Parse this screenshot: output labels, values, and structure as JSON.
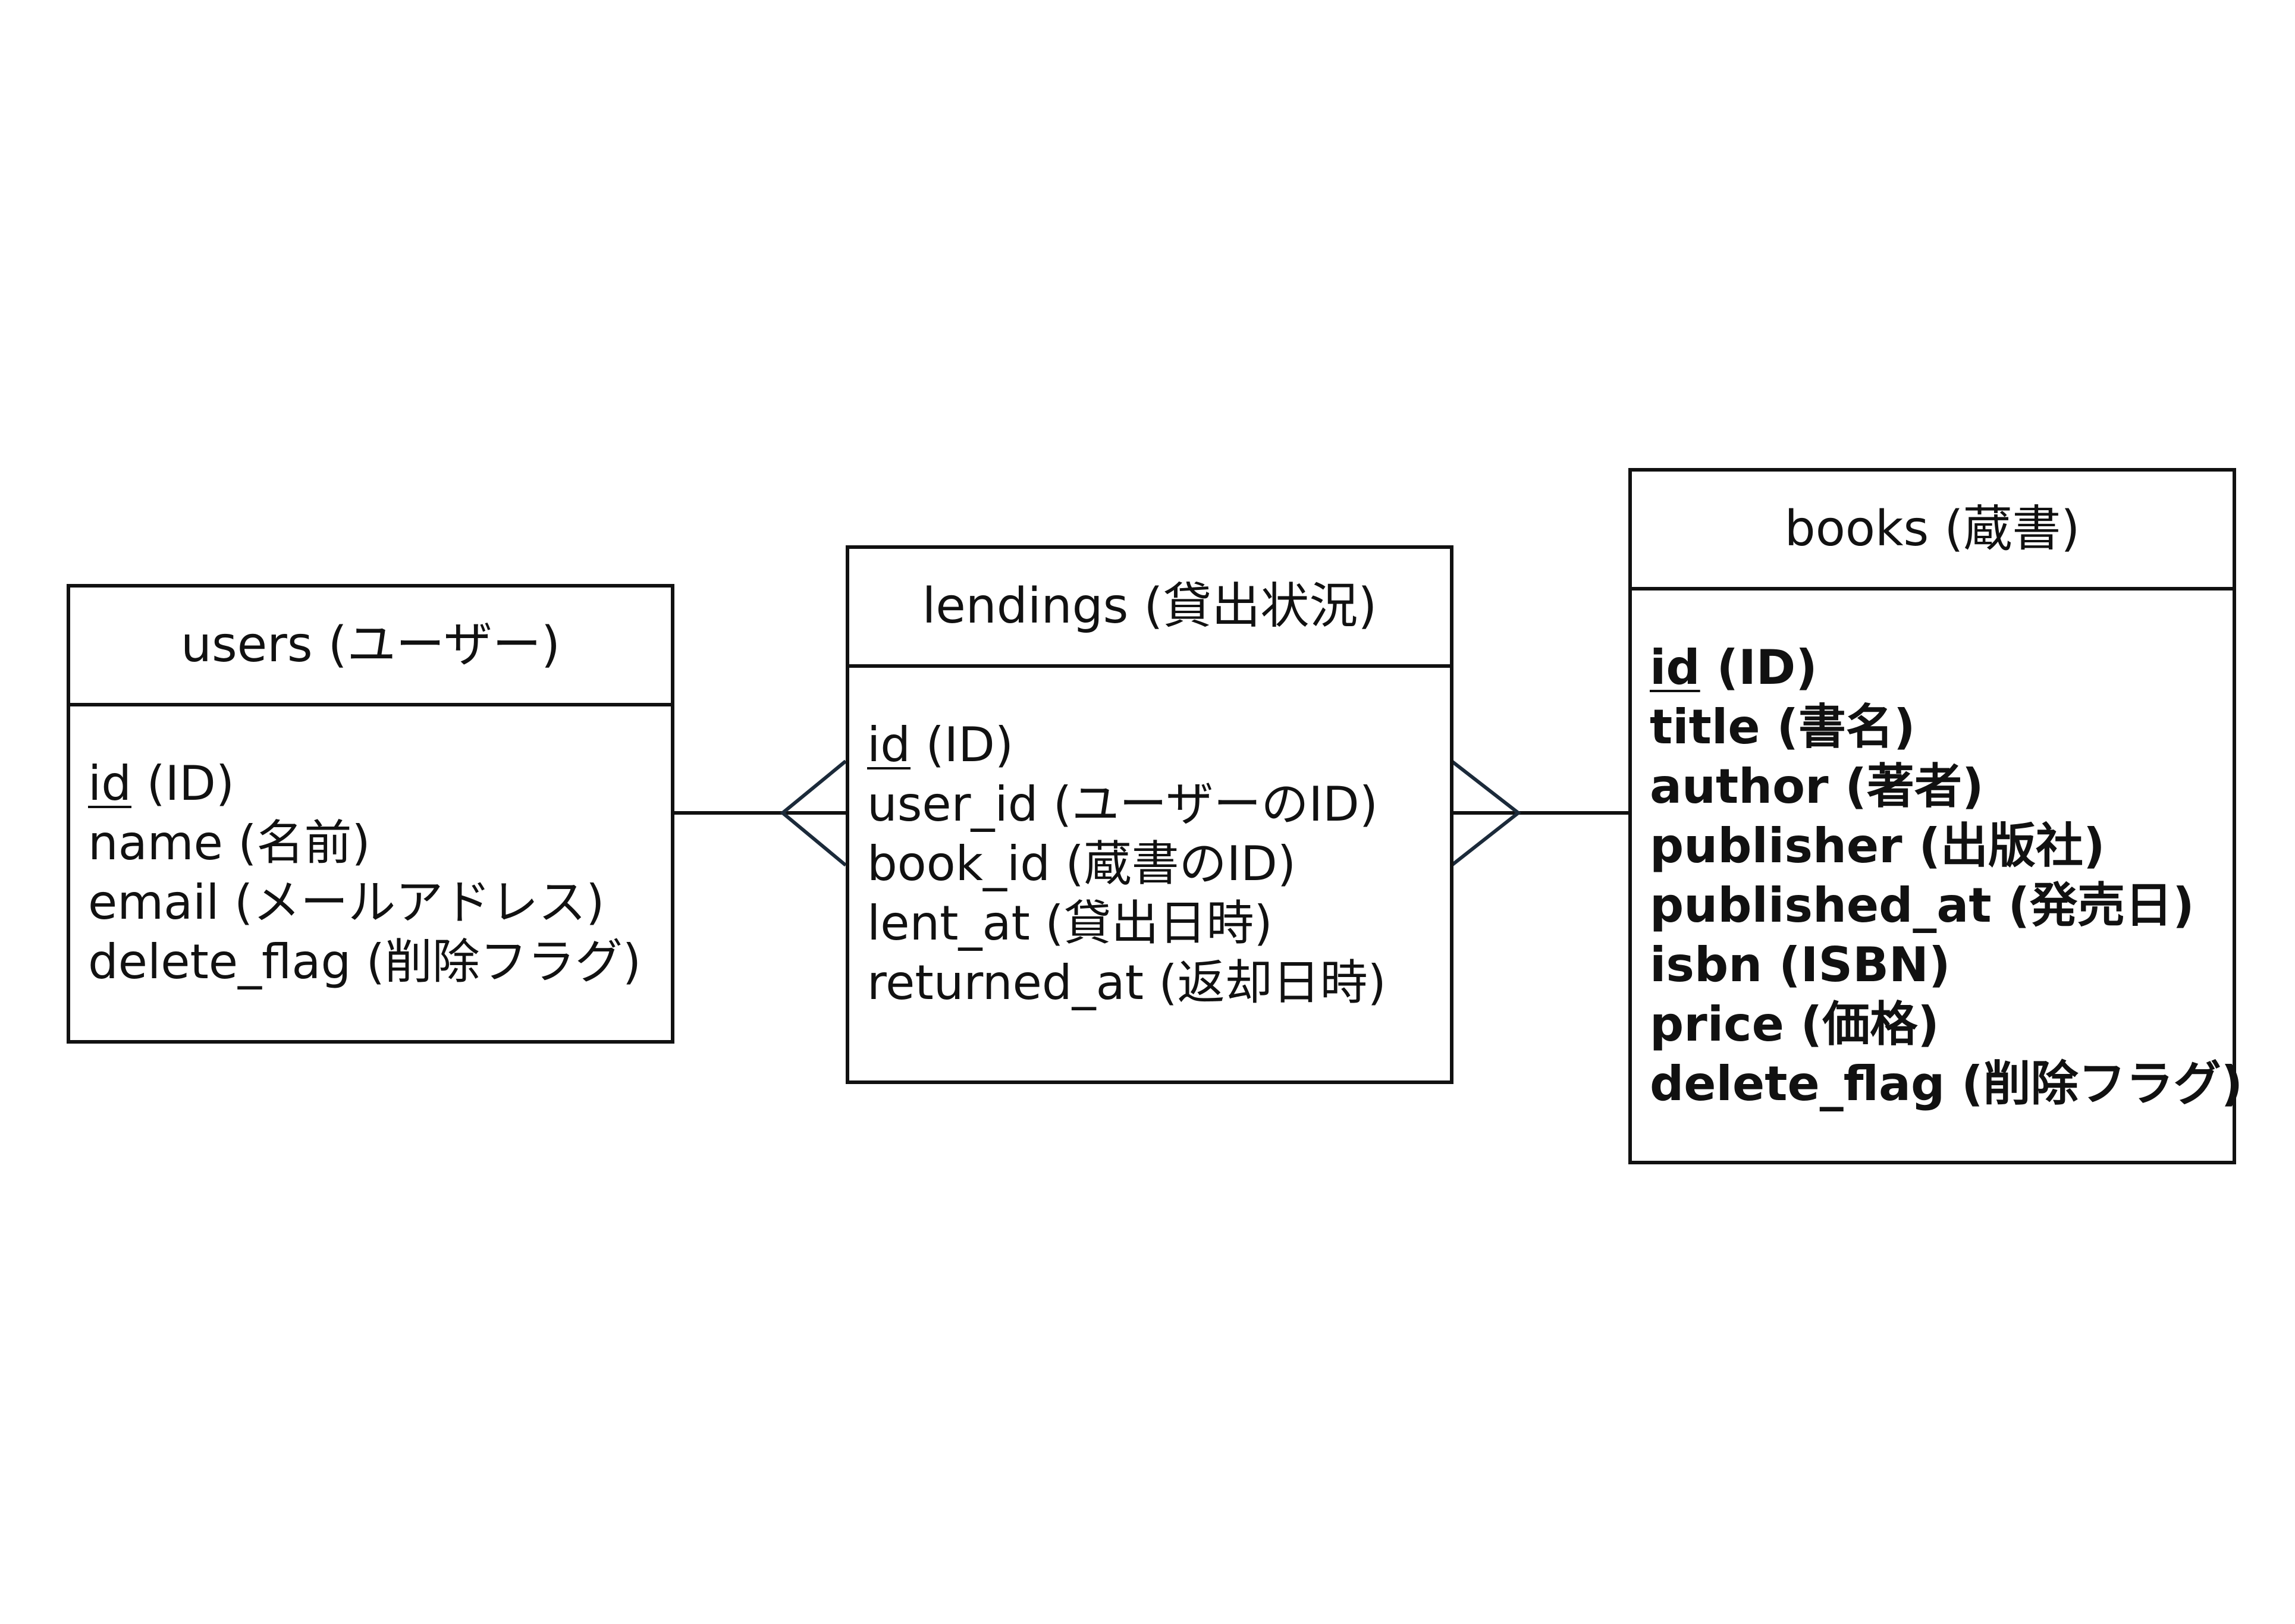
{
  "diagram": {
    "colors": {
      "line": "#111111",
      "crowsfoot": "#1b2a3a",
      "background": "#ffffff"
    },
    "entities": [
      {
        "id": "users",
        "title": "users (ユーザー)",
        "attributes": [
          {
            "name": "id",
            "desc": " (ID)",
            "pk": true
          },
          {
            "name": "name",
            "desc": " (名前)",
            "pk": false
          },
          {
            "name": "email",
            "desc": " (メールアドレス)",
            "pk": false
          },
          {
            "name": "delete_flag",
            "desc": " (削除フラグ)",
            "pk": false
          }
        ]
      },
      {
        "id": "lendings",
        "title": "lendings (貸出状況)",
        "attributes": [
          {
            "name": "id",
            "desc": " (ID)",
            "pk": true
          },
          {
            "name": "user_id",
            "desc": " (ユーザーのID)",
            "pk": false
          },
          {
            "name": "book_id",
            "desc": " (蔵書のID)",
            "pk": false
          },
          {
            "name": "lent_at",
            "desc": " (貸出日時)",
            "pk": false
          },
          {
            "name": "returned_at",
            "desc": " (返却日時)",
            "pk": false
          }
        ]
      },
      {
        "id": "books",
        "title": "books (蔵書)",
        "attributes": [
          {
            "name": "id",
            "desc": " (ID)",
            "pk": true
          },
          {
            "name": "title",
            "desc": " (書名)",
            "pk": false
          },
          {
            "name": "author",
            "desc": " (著者)",
            "pk": false
          },
          {
            "name": "publisher",
            "desc": " (出版社)",
            "pk": false
          },
          {
            "name": "published_at",
            "desc": " (発売日)",
            "pk": false
          },
          {
            "name": "isbn",
            "desc": " (ISBN)",
            "pk": false
          },
          {
            "name": "price",
            "desc": " (価格)",
            "pk": false
          },
          {
            "name": "delete_flag",
            "desc": " (削除フラグ)",
            "pk": false
          }
        ]
      }
    ],
    "relationships": [
      {
        "from": "users",
        "to": "lendings",
        "from_cardinality": "one",
        "to_cardinality": "many"
      },
      {
        "from": "books",
        "to": "lendings",
        "from_cardinality": "one",
        "to_cardinality": "many"
      }
    ]
  }
}
